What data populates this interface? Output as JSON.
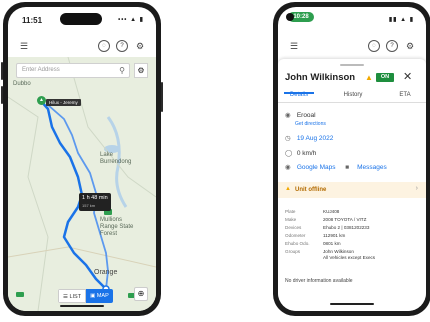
{
  "left_phone": {
    "status_time": "11:51",
    "status_sys": "••• ▲ ▮",
    "topbar": {
      "menu_icon": "☰",
      "chat_icon": "◌",
      "help_icon": "?",
      "settings_icon": "⚙"
    },
    "search_placeholder": "Enter Address",
    "map_labels": {
      "dubbo": "Dubbo",
      "lake_burrendong": "Lake Burrendong",
      "mullions": "Mullions Range State Forest",
      "orange": "Orange",
      "road_1": "32",
      "road_2": "A32"
    },
    "vehicle_tag": "Hilux - Jeremy",
    "eta_time": "1 h 48 min",
    "eta_distance": "157 km",
    "list_label": "LIST",
    "map_label": "MAP"
  },
  "right_phone": {
    "status_time": "10:28",
    "status_sys": "▮▮ ▲ ▮",
    "topbar": {
      "menu_icon": "☰",
      "chat_icon": "◌",
      "help_icon": "?",
      "settings_icon": "⚙"
    },
    "driver_name": "John Wilkinson",
    "on_badge": "ON",
    "tabs": {
      "details": "Details",
      "history": "History",
      "eta": "ETA"
    },
    "location": "Erooal",
    "get_directions": "Get directions",
    "date": "19 Aug 2022",
    "speed": "0 km/h",
    "google_maps": "Google Maps",
    "messages": "Messages",
    "offline_text": "Unit offline",
    "details": [
      {
        "k": "Plate",
        "v": "KUJ408"
      },
      {
        "k": "Make",
        "v": "2008 TOYOTA / VITZ"
      },
      {
        "k": "Devices",
        "v": "Ehubo 2 | 0381202233"
      },
      {
        "k": "Odometer",
        "v": "112901 km"
      },
      {
        "k": "Ehubo Odo.",
        "v": "0801 km"
      },
      {
        "k": "Groups",
        "v": "John Wilkinson"
      }
    ],
    "groups_second": "All Vehicles except Execs",
    "no_driver": "No driver information available"
  }
}
